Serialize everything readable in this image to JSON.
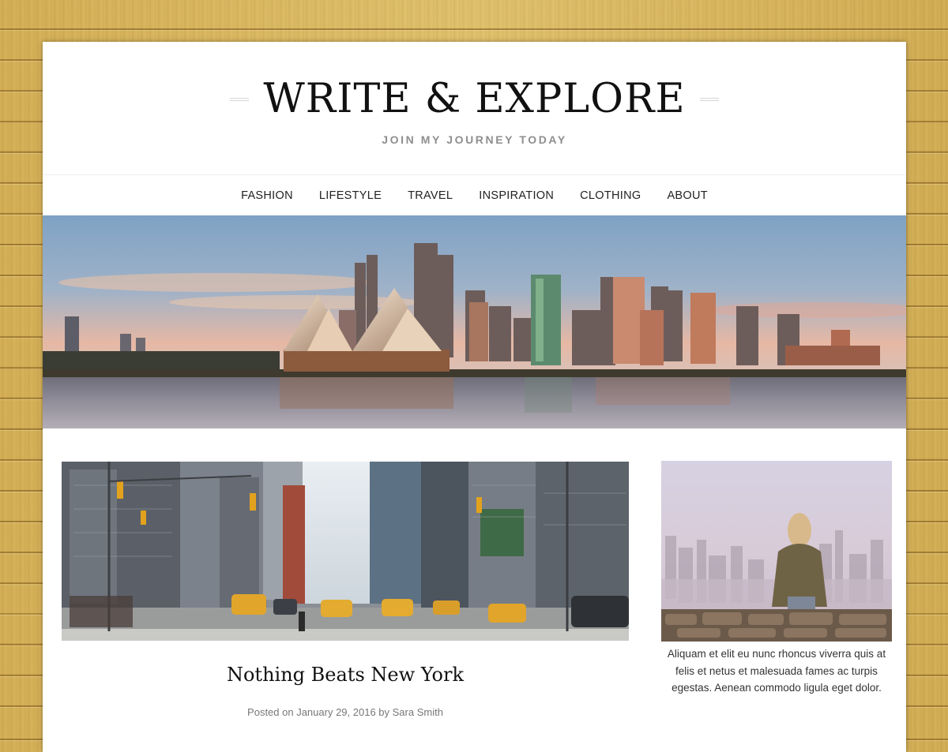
{
  "site": {
    "title": "WRITE & EXPLORE",
    "tagline": "JOIN MY JOURNEY TODAY"
  },
  "nav": {
    "items": [
      "FASHION",
      "LIFESTYLE",
      "TRAVEL",
      "INSPIRATION",
      "CLOTHING",
      "ABOUT"
    ]
  },
  "hero": {
    "image": "sydney-harbour-skyline-photo"
  },
  "post": {
    "image": "new-york-street-taxis-photo",
    "title": "Nothing Beats New York",
    "meta": "Posted on January 29, 2016 by Sara Smith"
  },
  "sidebar": {
    "widget_image": "woman-overlooking-city-photo",
    "widget_text": "Aliquam et elit eu nunc rhoncus viverra quis at felis et netus et malesuada fames ac turpis egestas. Aenean commodo ligula eget dolor."
  },
  "colors": {
    "wood_background": "#d9b65c",
    "page_background": "#ffffff",
    "title_text": "#111111",
    "tagline_text": "#8e8e8e",
    "nav_text": "#222222"
  }
}
